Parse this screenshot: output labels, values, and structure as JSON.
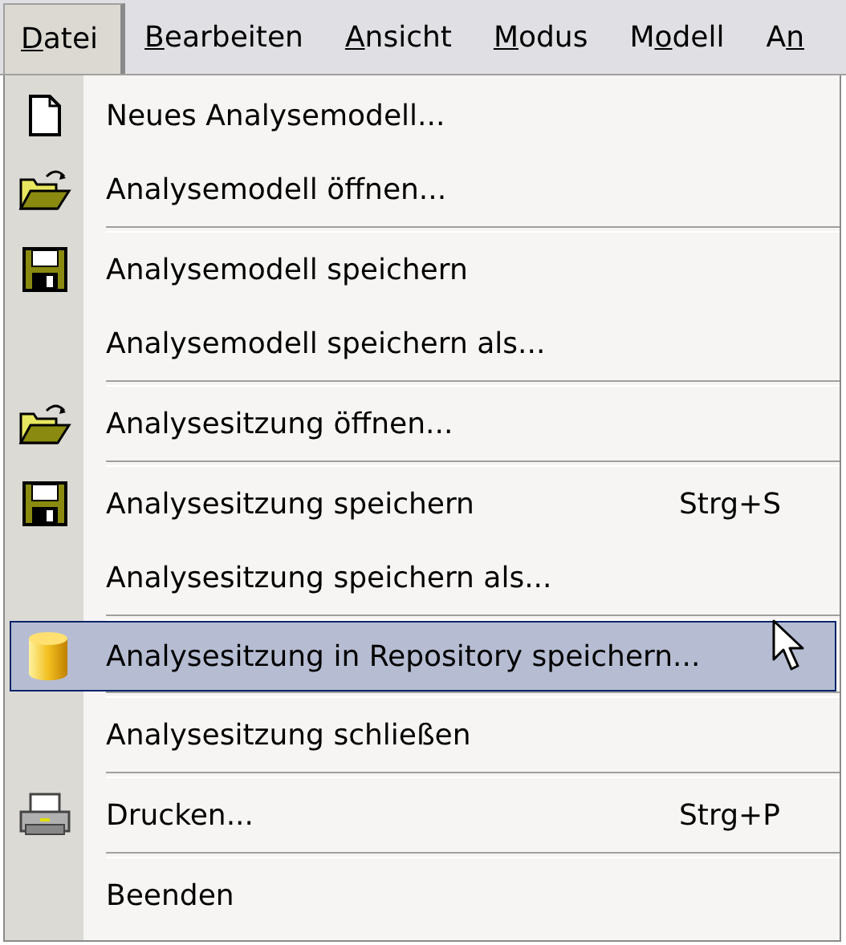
{
  "menu_bar": [
    {
      "accel": "D",
      "after": "atei",
      "selected": true
    },
    {
      "accel": "B",
      "after": "earbeiten",
      "selected": false
    },
    {
      "accel": "A",
      "after": "nsicht",
      "selected": false
    },
    {
      "accel": "M",
      "after": "odus",
      "selected": false
    },
    {
      "before": "M",
      "accel": "o",
      "after": "dell",
      "selected": false
    },
    {
      "before": "A",
      "accel": "n",
      "selected": false
    }
  ],
  "menu": [
    {
      "kind": "new",
      "label": "Neues Analysemodell...",
      "selected": false
    },
    {
      "kind": "open",
      "label": "Analysemodell öffnen...",
      "selected": false
    },
    {
      "kind": "separator"
    },
    {
      "kind": "save",
      "label": "Analysemodell speichern",
      "selected": false
    },
    {
      "kind": "plain",
      "label": "Analysemodell speichern als...",
      "selected": false
    },
    {
      "kind": "separator"
    },
    {
      "kind": "open",
      "label": "Analysesitzung öffnen...",
      "selected": false
    },
    {
      "kind": "separator"
    },
    {
      "kind": "save",
      "label": "Analysesitzung speichern",
      "shortcut": "Strg+S",
      "selected": false
    },
    {
      "kind": "plain",
      "label": "Analysesitzung speichern als...",
      "selected": false
    },
    {
      "kind": "separator"
    },
    {
      "kind": "database",
      "label": "Analysesitzung in Repository speichern...",
      "selected": true
    },
    {
      "kind": "separator"
    },
    {
      "kind": "plain",
      "label": "Analysesitzung schließen",
      "selected": false
    },
    {
      "kind": "separator"
    },
    {
      "kind": "print",
      "label": "Drucken...",
      "shortcut": "Strg+P",
      "selected": false
    },
    {
      "kind": "separator"
    },
    {
      "kind": "plain",
      "label": "Beenden",
      "selected": false
    }
  ]
}
